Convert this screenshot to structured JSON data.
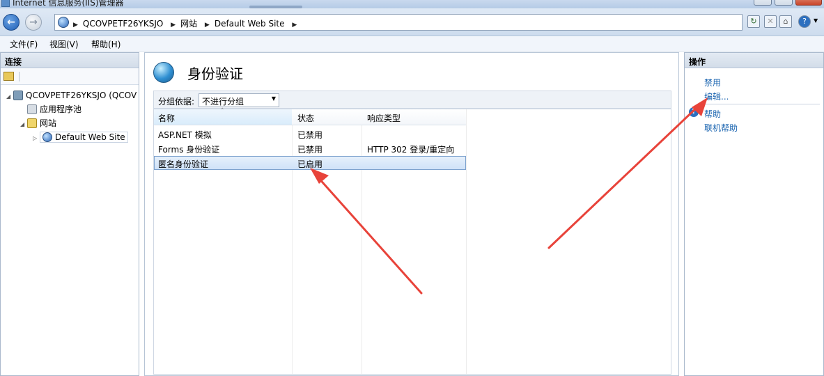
{
  "window": {
    "title": "Internet 信息服务(IIS)管理器"
  },
  "address": {
    "crumbs": [
      "QCOVPETF26YKSJO",
      "网站",
      "Default Web Site"
    ]
  },
  "menu": {
    "items": [
      "文件(F)",
      "视图(V)",
      "帮助(H)"
    ]
  },
  "connections": {
    "header": "连接",
    "tree": {
      "server": "QCOVPETF26YKSJO (QCOV",
      "app_pools": "应用程序池",
      "sites": "网站",
      "site": "Default Web Site"
    }
  },
  "feature": {
    "title": "身份验证",
    "group_label": "分组依据:",
    "group_value": "不进行分组",
    "columns": [
      "名称",
      "状态",
      "响应类型"
    ],
    "rows": [
      {
        "name": "ASP.NET 模拟",
        "status": "已禁用",
        "response": ""
      },
      {
        "name": "Forms 身份验证",
        "status": "已禁用",
        "response": "HTTP 302 登录/重定向"
      },
      {
        "name": "匿名身份验证",
        "status": "已启用",
        "response": ""
      }
    ]
  },
  "actions": {
    "header": "操作",
    "items": [
      "禁用",
      "编辑...",
      "帮助",
      "联机帮助"
    ]
  },
  "colors": {
    "annotation_arrow": "#e8433a",
    "link": "#1a64b0"
  }
}
